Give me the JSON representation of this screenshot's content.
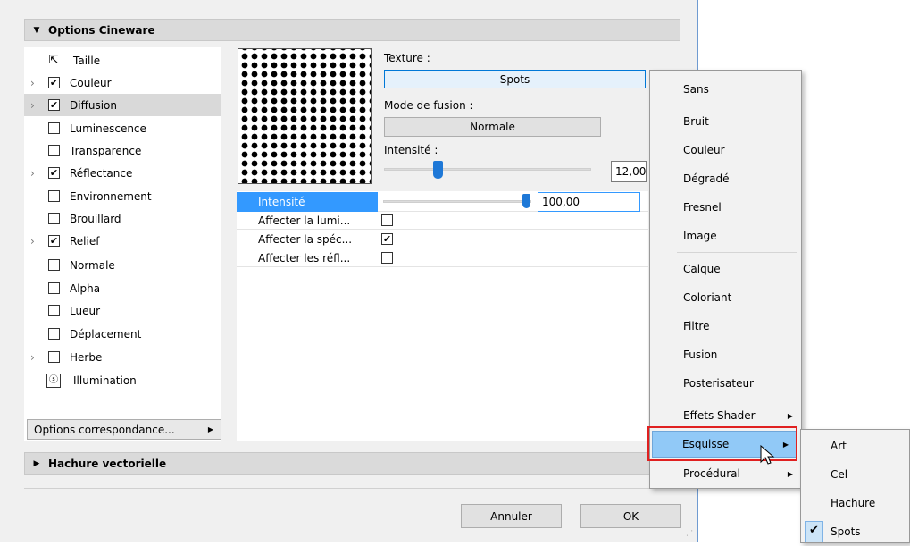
{
  "dialog": {
    "section_header": "Options Cineware",
    "section_footer": "Hachure vectorielle",
    "options_button": "Options correspondance...",
    "cancel_button": "Annuler",
    "ok_button": "OK"
  },
  "channels": [
    {
      "label": "Taille",
      "icon": "resize-icon"
    },
    {
      "label": "Couleur",
      "checked": true,
      "expandable": true
    },
    {
      "label": "Diffusion",
      "checked": true,
      "expandable": true,
      "selected": true
    },
    {
      "label": "Luminescence",
      "checked": false
    },
    {
      "label": "Transparence",
      "checked": false
    },
    {
      "label": "Réflectance",
      "checked": true,
      "expandable": true
    },
    {
      "label": "Environnement",
      "checked": false
    },
    {
      "label": "Brouillard",
      "checked": false
    },
    {
      "label": "Relief",
      "checked": true,
      "expandable": true
    },
    {
      "label": "Normale",
      "checked": false
    },
    {
      "label": "Alpha",
      "checked": false
    },
    {
      "label": "Lueur",
      "checked": false
    },
    {
      "label": "Déplacement",
      "checked": false
    },
    {
      "label": "Herbe",
      "checked": false,
      "expandable": true
    },
    {
      "label": "Illumination",
      "icon": "illumination-icon"
    }
  ],
  "texture": {
    "label": "Texture :",
    "value": "Spots",
    "fusion_label": "Mode de fusion :",
    "fusion_value": "Normale",
    "intensity_label": "Intensité :",
    "intensity_value": "12,00",
    "intensity_level": 0.25
  },
  "params": {
    "selected_label": "Intensité",
    "selected_value": "100,00",
    "selected_level": 1.0,
    "rows": [
      {
        "label": "Affecter la lumi...",
        "checked": false
      },
      {
        "label": "Affecter la spéc...",
        "checked": true
      },
      {
        "label": "Affecter les réfl...",
        "checked": false
      }
    ]
  },
  "menu": {
    "items": [
      "Sans",
      "Bruit",
      "Couleur",
      "Dégradé",
      "Fresnel",
      "Image",
      "Calque",
      "Coloriant",
      "Filtre",
      "Fusion",
      "Posterisateur",
      "Effets Shader",
      "Esquisse",
      "Procédural"
    ],
    "highlighted": "Esquisse"
  },
  "submenu": {
    "items": [
      "Art",
      "Cel",
      "Hachure",
      "Spots"
    ],
    "checked": "Spots"
  },
  "colors": {
    "accent": "#1e78d7",
    "selection": "#3399ff",
    "highlight_box": "#e02020"
  }
}
